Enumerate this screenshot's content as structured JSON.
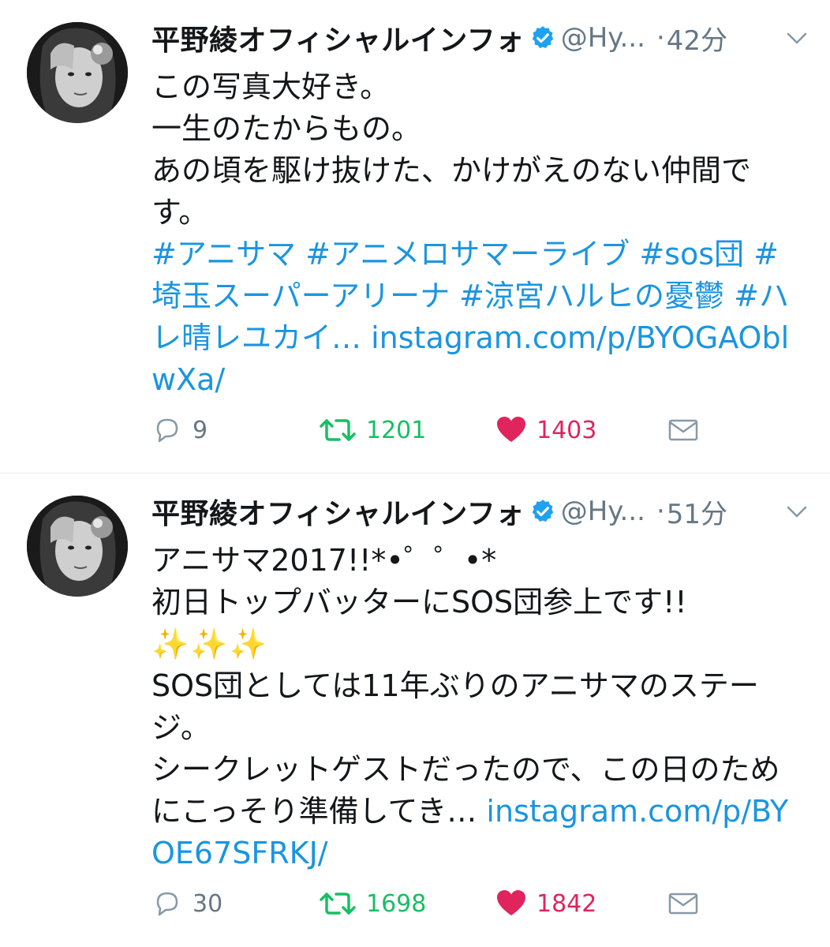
{
  "colors": {
    "link": "#1b95e0",
    "retweet": "#17bf63",
    "like": "#e0245e",
    "muted": "#657786",
    "verified": "#1da1f2"
  },
  "tweets": [
    {
      "author_name": "平野綾オフィシャルインフォ",
      "handle": "@Hy...",
      "separator": "·",
      "time": "42分",
      "body_lines": [
        "この写真大好き。",
        "一生のたからもの。",
        "あの頃を駆け抜けた、かけがえのない仲間です。"
      ],
      "hashtags": "#アニサマ #アニメロサマーライブ #sos団 #埼玉スーパーアリーナ #涼宮ハルヒの憂鬱 #ハレ晴レユカイ…",
      "link_text": "instagram.com/p/BYOGAOblwXa/",
      "reply_count": "9",
      "retweet_count": "1201",
      "like_count": "1403"
    },
    {
      "author_name": "平野綾オフィシャルインフォ",
      "handle": "@Hy...",
      "separator": "·",
      "time": "51分",
      "body_lines": [
        "アニサマ2017!!*•゜゜•*",
        "初日トップバッターにSOS団参上です!!"
      ],
      "sparkles": "✨✨✨",
      "body_lines_2": [
        "SOS団としては11年ぶりのアニサマのステージ。"
      ],
      "body_tail": "シークレットゲストだったので、この日のためにこっそり準備してき…",
      "link_text": "instagram.com/p/BYOE67SFRKJ/",
      "reply_count": "30",
      "retweet_count": "1698",
      "like_count": "1842"
    }
  ]
}
